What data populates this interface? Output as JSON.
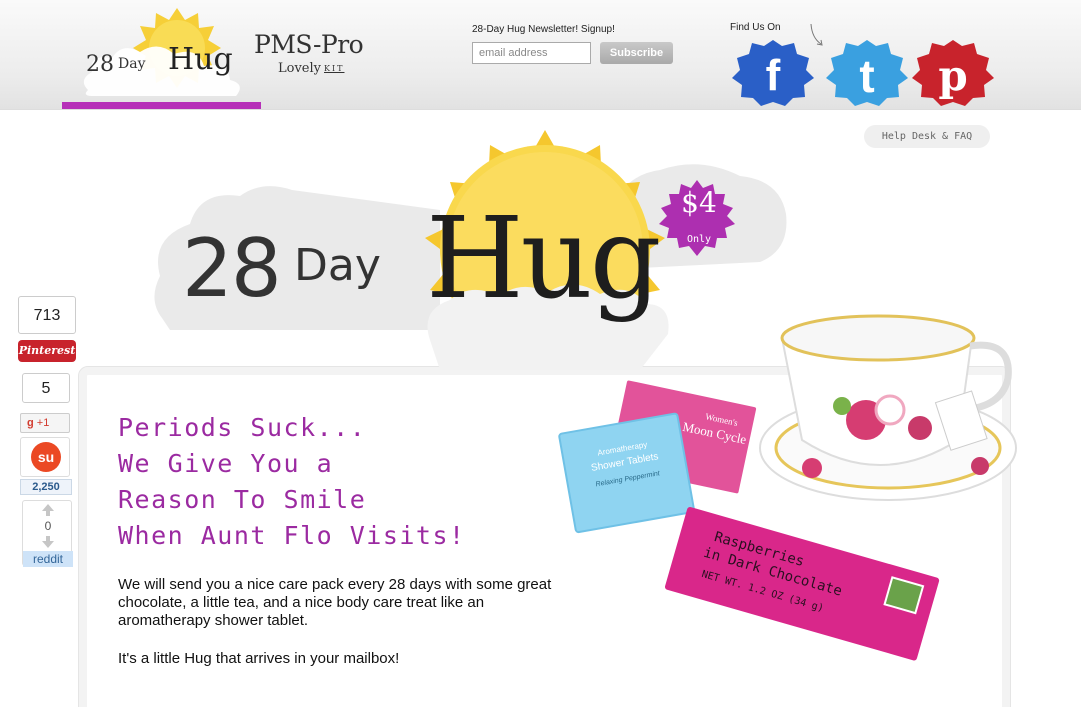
{
  "header": {
    "logo": {
      "num": "28",
      "day": "Day",
      "hug": "Hug"
    },
    "pms": {
      "title": "PMS-Pro",
      "sub": "Lovely",
      "kit": "KIT"
    },
    "newsletter": {
      "label": "28-Day Hug Newsletter! Signup!",
      "placeholder": "email address",
      "button": "Subscribe"
    },
    "find_us": "Find Us On",
    "social": [
      {
        "name": "facebook-icon",
        "glyph": "f",
        "color": "#2a5fc7"
      },
      {
        "name": "twitter-icon",
        "glyph": "t",
        "color": "#3aa0e0"
      },
      {
        "name": "pinterest-icon",
        "glyph": "p",
        "color": "#c8232c"
      }
    ]
  },
  "help": {
    "label": "Help Desk & FAQ"
  },
  "hero": {
    "num": "28",
    "day": "Day",
    "hug": "Hug",
    "price": "$4",
    "price_sub": "Only"
  },
  "content": {
    "headline": [
      "Periods Suck...",
      "We Give You a",
      "Reason To Smile",
      "When Aunt Flo Visits!"
    ],
    "body": "We will send you a nice care pack every 28 days with some great chocolate, a little tea, and a nice body care treat like an aromatherapy shower tablet.",
    "body2": "It's a little Hug that arrives in your mailbox!",
    "product": {
      "tea_packet": "Women's Moon Cycle",
      "tablet_title": "Aromatherapy Shower Tablets",
      "tablet_sub": "Relaxing Peppermint",
      "chocolate_line1": "Raspberries",
      "chocolate_line2": "in Dark Chocolate",
      "chocolate_weight": "NET WT. 1.2 OZ (34 g)"
    }
  },
  "share": {
    "pinterest_count": "713",
    "pinterest_label": "Pinterest",
    "gplus_count": "5",
    "gplus_label": "+1",
    "stumble_count": "2,250",
    "reddit_count": "0",
    "reddit_label": "reddit"
  }
}
